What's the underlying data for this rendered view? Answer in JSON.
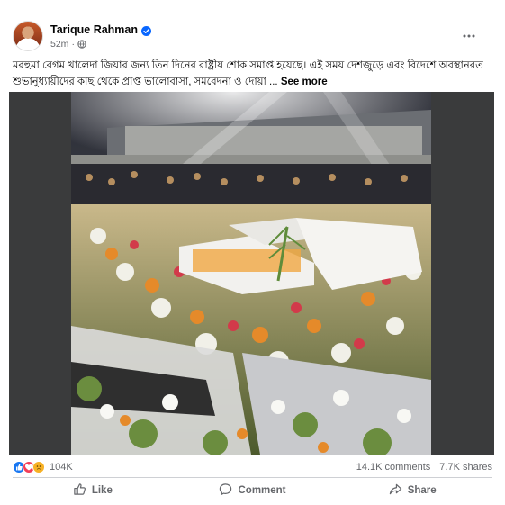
{
  "post": {
    "author": "Tarique Rahman",
    "time": "52m",
    "text": "মরহুমা বেগম খালেদা জিয়ার জন্য তিন দিনের রাষ্ট্রীয় শোক সমাপ্ত হয়েছে। এই সময় দেশজুড়ে এবং বিদেশে অবস্থানরত শুভানুধ্যায়ীদের কাছ থেকে প্রাপ্ত ভালোবাসা, সমবেদনা ও দোয়া ...",
    "see_more": "See more"
  },
  "icons": {
    "verified": "verified-badge-icon",
    "audience": "globe-icon",
    "more": "more-options-icon",
    "reactions": [
      "like-reaction-icon",
      "love-reaction-icon",
      "sad-reaction-icon"
    ]
  },
  "colors": {
    "verified": "#0866ff",
    "like": "#1877f2",
    "love": "#f33e58",
    "sad": "#f7b125",
    "secondary_text": "#65676b"
  },
  "stats": {
    "reactions": "104K",
    "comments": "14.1K comments",
    "shares": "7.7K shares"
  },
  "actions": {
    "like": "Like",
    "comment": "Comment",
    "share": "Share"
  }
}
